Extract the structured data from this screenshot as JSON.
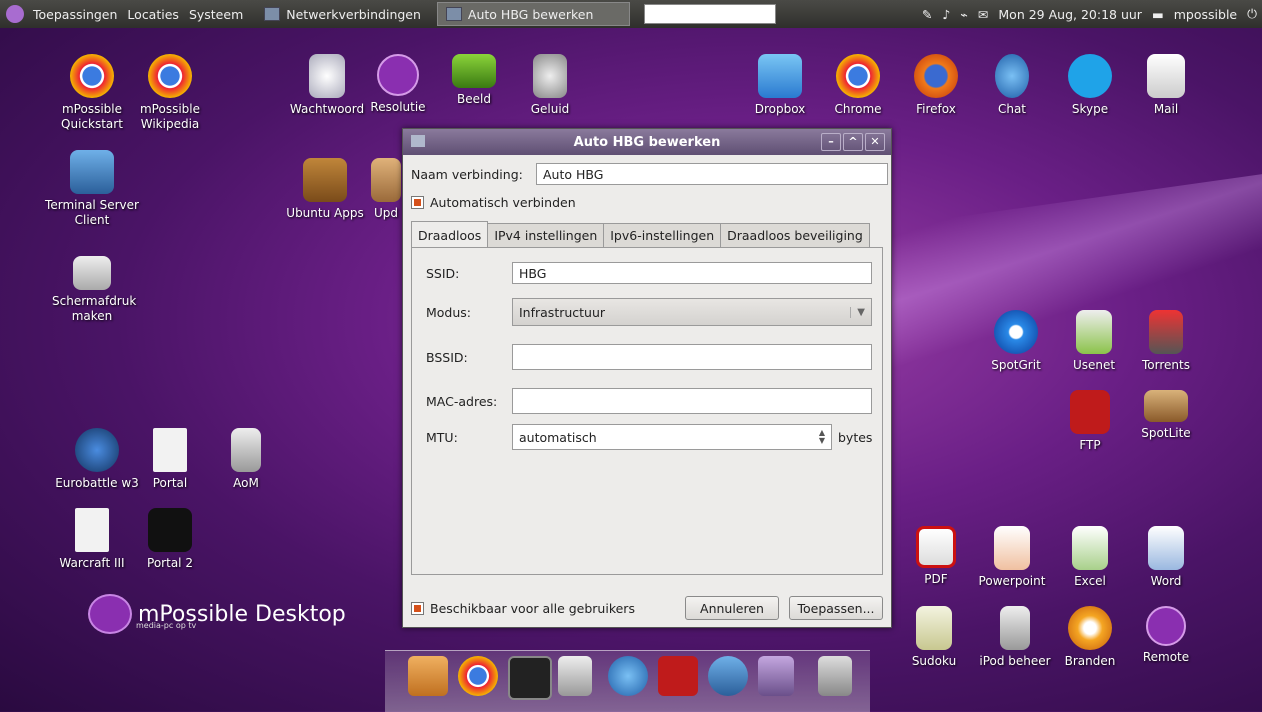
{
  "topbar": {
    "menus": [
      "Toepassingen",
      "Locaties",
      "Systeem"
    ],
    "tasks": [
      "Netwerkverbindingen",
      "Auto HBG bewerken"
    ],
    "clock": "Mon 29 Aug, 20:18 uur",
    "user": "mpossible"
  },
  "desktop": {
    "left_icons": [
      {
        "label": "mPossible\nQuickstart"
      },
      {
        "label": "mPossible\nWikipedia"
      },
      {
        "label": "Terminal Server\nClient"
      },
      {
        "label": "Schermafdruk\nmaken"
      },
      {
        "label": "Eurobattle w3"
      },
      {
        "label": "Portal"
      },
      {
        "label": "AoM"
      },
      {
        "label": "Warcraft III"
      },
      {
        "label": "Portal 2"
      },
      {
        "label": "Ubuntu Apps"
      },
      {
        "label": "Upd"
      }
    ],
    "top_icons": [
      "Wachtwoord",
      "Resolutie",
      "Beeld",
      "Geluid",
      "Dropbox",
      "Chrome",
      "Firefox",
      "Chat",
      "Skype",
      "Mail"
    ],
    "right_icons": [
      "SpotGrit",
      "Usenet",
      "Torrents",
      "FTP",
      "SpotLite",
      "PDF",
      "Powerpoint",
      "Excel",
      "Word",
      "Sudoku",
      "iPod beheer",
      "Branden",
      "Remote"
    ],
    "brand": {
      "name": "mPossible Desktop",
      "sub": "media-pc op tv"
    }
  },
  "dialog": {
    "title": "Auto HBG bewerken",
    "name_label": "Naam verbinding:",
    "name_value": "Auto HBG",
    "auto_connect_label": "Automatisch verbinden",
    "auto_connect_checked": true,
    "tabs": [
      "Draadloos",
      "IPv4 instellingen",
      "Ipv6-instellingen",
      "Draadloos beveiliging"
    ],
    "selected_tab": "Draadloos",
    "ssid_label": "SSID:",
    "ssid_value": "HBG",
    "mode_label": "Modus:",
    "mode_value": "Infrastructuur",
    "bssid_label": "BSSID:",
    "bssid_value": "",
    "mac_label": "MAC-adres:",
    "mac_value": "",
    "mtu_label": "MTU:",
    "mtu_value": "automatisch",
    "mtu_unit": "bytes",
    "all_users_label": "Beschikbaar voor alle gebruikers",
    "all_users_checked": true,
    "cancel_label": "Annuleren",
    "apply_label": "Toepassen..."
  }
}
